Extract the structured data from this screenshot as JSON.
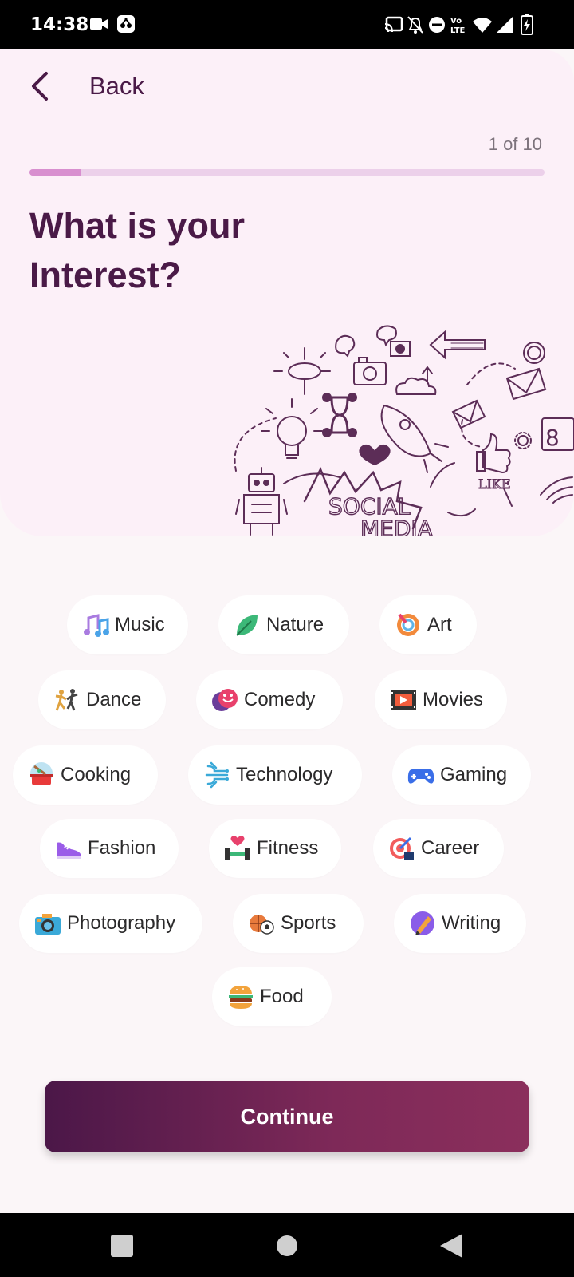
{
  "status_bar": {
    "time": "14:38",
    "icons": [
      "video-camera-icon",
      "screen-record-icon",
      "cast-icon",
      "bell-off-icon",
      "do-not-disturb-icon",
      "volte-icon",
      "wifi-icon",
      "signal-icon",
      "battery-charging-icon"
    ]
  },
  "header": {
    "back_label": "Back",
    "back_icon": "chevron-left-icon",
    "progress_text": "1 of 10",
    "progress_fraction": 0.1,
    "title": "What is your Interest?"
  },
  "colors": {
    "primary": "#4a1a47",
    "hero_bg": "#fcf0f8",
    "progress": "#d88fcf",
    "button_start": "#4b1748",
    "button_end": "#8b2f5c"
  },
  "interests": [
    {
      "label": "Music",
      "icon": "music-notes-icon"
    },
    {
      "label": "Nature",
      "icon": "leaf-icon"
    },
    {
      "label": "Art",
      "icon": "palette-icon"
    },
    {
      "label": "Dance",
      "icon": "dancers-icon"
    },
    {
      "label": "Comedy",
      "icon": "theater-masks-icon"
    },
    {
      "label": "Movies",
      "icon": "film-strip-icon"
    },
    {
      "label": "Cooking",
      "icon": "cooking-pot-icon"
    },
    {
      "label": "Technology",
      "icon": "circuit-icon"
    },
    {
      "label": "Gaming",
      "icon": "game-controller-icon"
    },
    {
      "label": "Fashion",
      "icon": "sneaker-icon"
    },
    {
      "label": "Fitness",
      "icon": "dumbbell-heart-icon"
    },
    {
      "label": "Career",
      "icon": "target-icon"
    },
    {
      "label": "Photography",
      "icon": "camera-icon"
    },
    {
      "label": "Sports",
      "icon": "sports-balls-icon"
    },
    {
      "label": "Writing",
      "icon": "pen-writing-icon"
    },
    {
      "label": "Food",
      "icon": "burger-icon"
    }
  ],
  "continue_label": "Continue",
  "nav": {
    "recents_icon": "square-recents-icon",
    "home_icon": "circle-home-icon",
    "back_icon": "triangle-back-icon"
  }
}
